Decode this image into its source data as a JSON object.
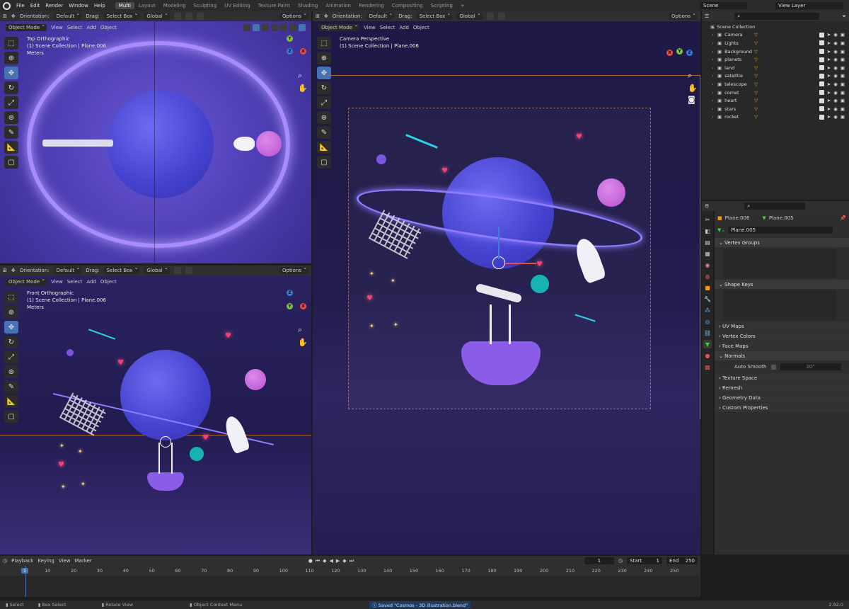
{
  "menu": [
    "File",
    "Edit",
    "Render",
    "Window",
    "Help"
  ],
  "workspaces": [
    "Multi",
    "Layout",
    "Modeling",
    "Sculpting",
    "UV Editing",
    "Texture Paint",
    "Shading",
    "Animation",
    "Rendering",
    "Compositing",
    "Scripting"
  ],
  "add_workspace": "+",
  "scene": "Scene",
  "view_layer": "View Layer",
  "viewport_header": {
    "orientation_label": "Orientation:",
    "orientation_value": "Default",
    "drag_label": "Drag:",
    "drag_value": "Select Box",
    "transform": "Global",
    "options": "Options"
  },
  "viewport_menu": {
    "mode": "Object Mode",
    "view": "View",
    "select": "Select",
    "add": "Add",
    "object": "Object"
  },
  "viewports": {
    "top": {
      "title": "Top Orthographic",
      "collection": "(1) Scene Collection | Plane.006",
      "units": "Meters"
    },
    "front": {
      "title": "Front Orthographic",
      "collection": "(1) Scene Collection | Plane.006",
      "units": "Meters"
    },
    "camera": {
      "title": "Camera Perspective",
      "collection": "(1) Scene Collection | Plane.006"
    }
  },
  "gizmo": {
    "x": "X",
    "y": "Y",
    "z": "Z"
  },
  "outliner": {
    "root": "Scene Collection",
    "items": [
      "Camera",
      "Lights",
      "Background",
      "planets",
      "land",
      "satellite",
      "telescope",
      "comet",
      "heart",
      "stars",
      "rocket"
    ]
  },
  "properties": {
    "object_name": "Plane.006",
    "mesh_name": "Plane.005",
    "datablock": "Plane.005",
    "panels": [
      "Vertex Groups",
      "Shape Keys",
      "UV Maps",
      "Vertex Colors",
      "Face Maps",
      "Normals",
      "Texture Space",
      "Remesh",
      "Geometry Data",
      "Custom Properties"
    ],
    "auto_smooth_label": "Auto Smooth",
    "auto_smooth_angle": "30°"
  },
  "timeline": {
    "menus": [
      "Playback",
      "Keying",
      "View",
      "Marker"
    ],
    "current_frame": "1",
    "start_label": "Start",
    "start": "1",
    "end_label": "End",
    "end": "250",
    "ticks": [
      "1",
      "10",
      "20",
      "30",
      "40",
      "50",
      "60",
      "70",
      "80",
      "90",
      "100",
      "110",
      "120",
      "130",
      "140",
      "150",
      "160",
      "170",
      "180",
      "190",
      "200",
      "210",
      "220",
      "230",
      "240",
      "250"
    ]
  },
  "statusbar": {
    "select": "Select",
    "box_select": "Box Select",
    "rotate_view": "Rotate View",
    "context_menu": "Object Context Menu",
    "saved": "Saved \"Cosmos - 3D illustration.blend\"",
    "version": "2.92.0"
  },
  "colors": {
    "accent": "#4772b3",
    "planet": "#4b4ad6",
    "ring": "#9f7bff",
    "heart": "#ff3d6e",
    "teal": "#17b3b3",
    "pink": "#c45ee0"
  }
}
